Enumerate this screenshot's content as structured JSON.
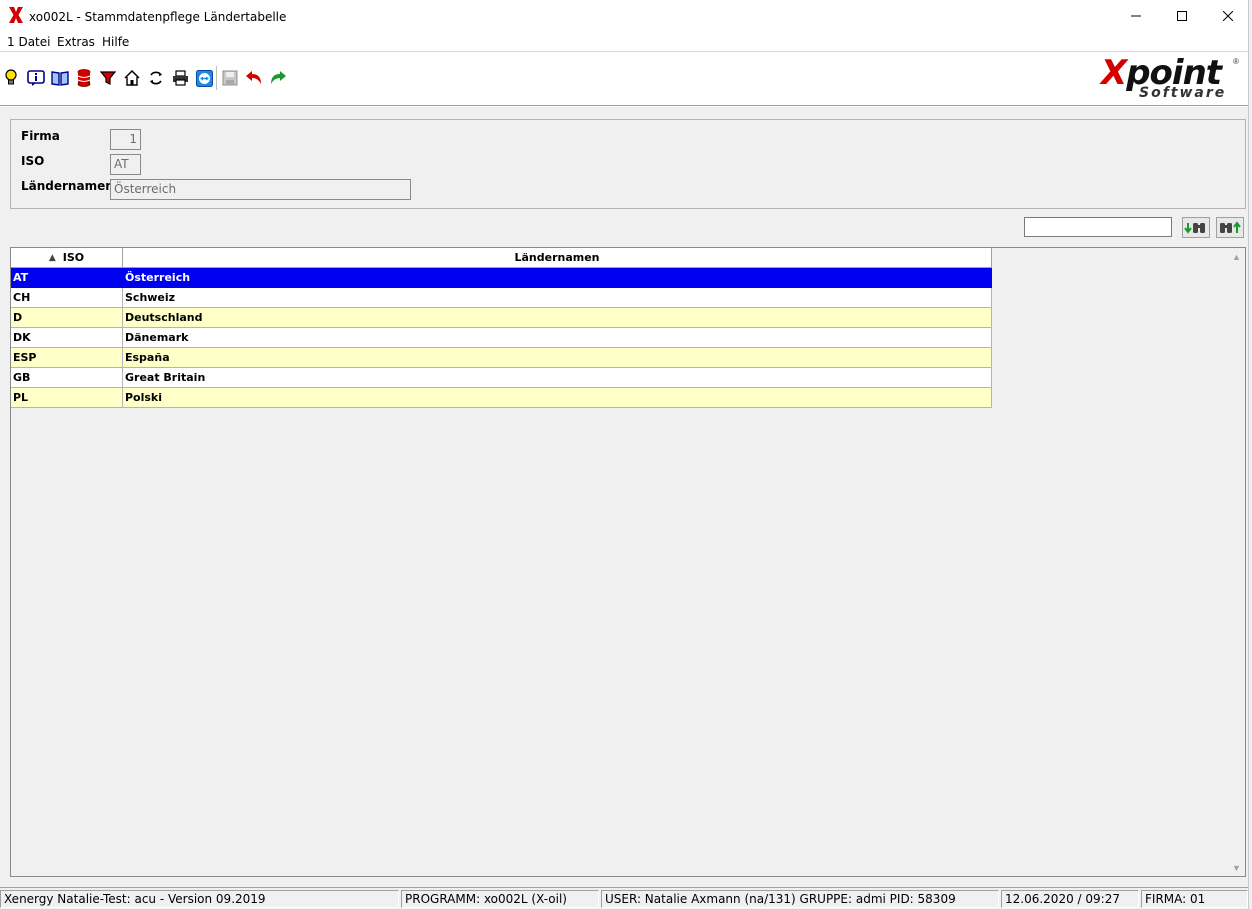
{
  "window": {
    "title": "xo002L - Stammdatenpflege Ländertabelle",
    "app_icon": "xpoint-x-icon",
    "controls": [
      "minimize-icon",
      "maximize-icon",
      "close-icon"
    ]
  },
  "menu": {
    "items": [
      "1 Datei",
      "Extras",
      "Hilfe"
    ]
  },
  "toolbar": {
    "buttons": [
      {
        "name": "lightbulb-icon"
      },
      {
        "name": "info-icon"
      },
      {
        "name": "book-icon"
      },
      {
        "name": "database-icon"
      },
      {
        "name": "filter-icon"
      },
      {
        "name": "home-icon"
      },
      {
        "name": "refresh-icon"
      },
      {
        "name": "print-icon"
      },
      {
        "name": "teamviewer-icon"
      },
      {
        "name": "save-icon"
      },
      {
        "name": "undo-icon"
      },
      {
        "name": "redo-icon"
      }
    ],
    "logo": {
      "text_x": "X",
      "text_rest": "point",
      "subtitle": "Software",
      "reg": "®"
    }
  },
  "form": {
    "firma_label": "Firma",
    "firma_value": "1",
    "iso_label": "ISO",
    "iso_value": "AT",
    "laendernamen_label": "Ländernamen",
    "laendernamen_value": "Österreich"
  },
  "search": {
    "value": "",
    "find_down_icon": "binoculars-down-icon",
    "find_up_icon": "binoculars-up-icon"
  },
  "grid": {
    "columns": [
      "ISO",
      "Ländernamen"
    ],
    "sort_column": "ISO",
    "rows": [
      {
        "iso": "AT",
        "name": "Österreich",
        "style": "selected"
      },
      {
        "iso": "CH",
        "name": "Schweiz",
        "style": "white"
      },
      {
        "iso": "D",
        "name": "Deutschland",
        "style": "yellow"
      },
      {
        "iso": "DK",
        "name": "Dänemark",
        "style": "white"
      },
      {
        "iso": "ESP",
        "name": "España",
        "style": "yellow"
      },
      {
        "iso": "GB",
        "name": "Great Britain",
        "style": "white"
      },
      {
        "iso": "PL",
        "name": "Polski",
        "style": "yellow"
      }
    ]
  },
  "status": {
    "version": "Xenergy Natalie-Test: acu - Version 09.2019",
    "program": "PROGRAMM: xo002L (X-oil)",
    "user": "USER: Natalie Axmann (na/131)  GRUPPE: admi  PID: 58309",
    "datetime": "12.06.2020 / 09:27",
    "firma": "FIRMA: 01"
  },
  "colors": {
    "selected_row": "#0000f0",
    "alt_row": "#ffffc8",
    "logo_red": "#d40000"
  }
}
